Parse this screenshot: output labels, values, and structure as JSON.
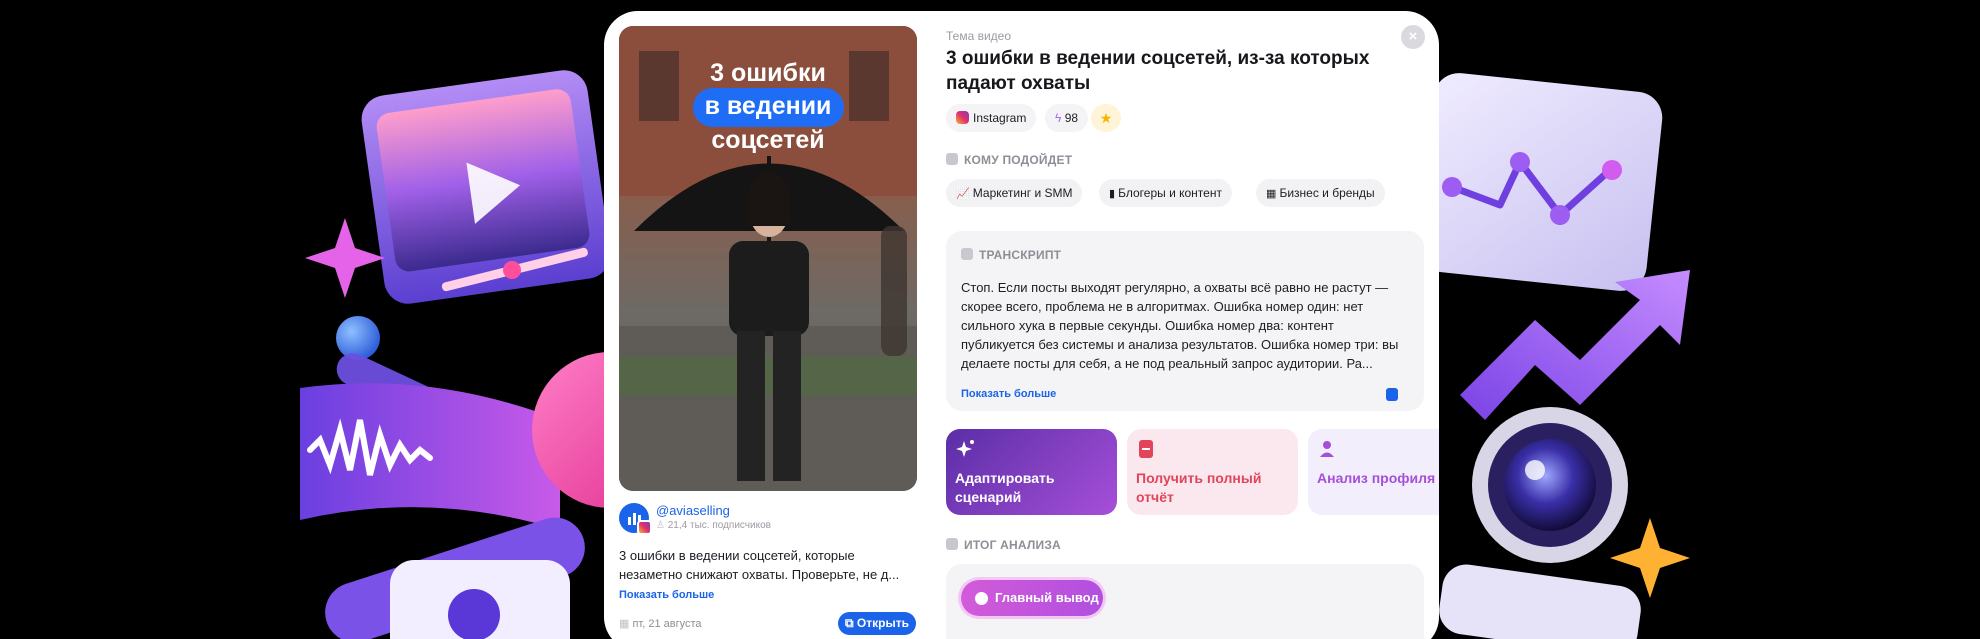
{
  "card": {
    "close_icon": "close-icon",
    "video": {
      "overlay_line1": "3 ошибки",
      "overlay_line2": "в ведении",
      "overlay_line3": "соцсетей"
    },
    "author": {
      "handle": "@aviaselling",
      "subscribers": "21,4 тыс. подписчиков"
    },
    "description": "3 ошибки в ведении соцсетей, которые незаметно снижают охваты. Проверьте, не д...",
    "show_more_left": "Показать больше",
    "date": "пт, 21 августа",
    "open_button": "Открыть",
    "theme_label": "Тема видео",
    "title": "3 ошибки в ведении соцсетей, из-за которых падают охваты",
    "chips": {
      "platform": "Instagram",
      "score": "98"
    },
    "audience": {
      "label": "КОМУ ПОДОЙДЕТ",
      "tags": [
        "Маркетинг и SMM",
        "Блогеры и контент",
        "Бизнес и бренды"
      ]
    },
    "transcript": {
      "label": "ТРАНСКРИПТ",
      "text": "Стоп. Если посты выходят регулярно, а охваты всё равно не растут — скорее всего, проблема не в алгоритмах. Ошибка номер один: нет сильного хука в первые секунды. Ошибка номер два: контент публикуется без системы и анализа результатов. Ошибка номер три: вы делаете посты для себя, а не под реальный запрос аудитории. Ра...",
      "show_more": "Показать больше"
    },
    "actions": [
      {
        "label": "Адаптировать сценарий",
        "icon": "sparkle-icon"
      },
      {
        "label": "Получить полный отчёт",
        "icon": "pdf-icon"
      },
      {
        "label": "Анализ профиля",
        "icon": "user-icon"
      }
    ],
    "summary": {
      "label": "ИТОГ АНАЛИЗА",
      "main_pill": "Главный вывод"
    }
  },
  "colors": {
    "accent_blue": "#1b63e8",
    "accent_purple": "#a64fd8",
    "action_red": "#e0455a"
  }
}
